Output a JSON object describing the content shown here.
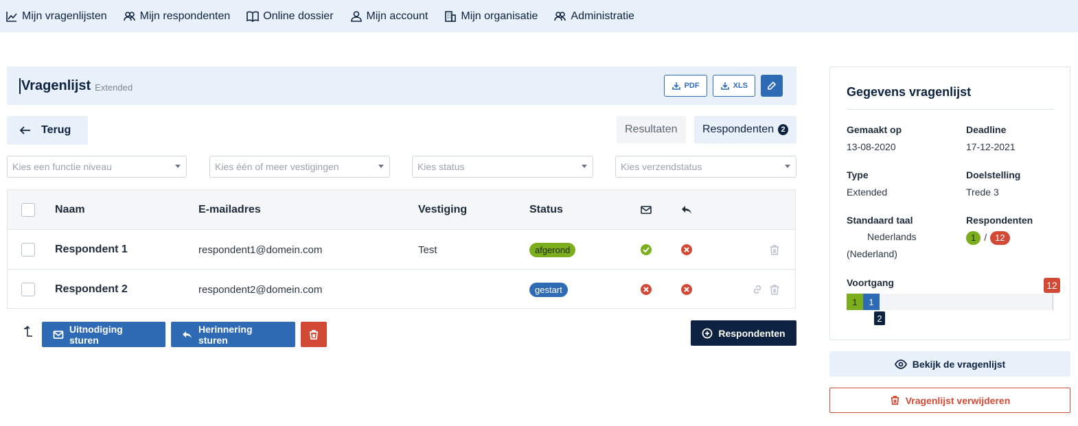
{
  "nav": [
    {
      "label": "Mijn vragenlijsten",
      "icon": "chart-icon"
    },
    {
      "label": "Mijn respondenten",
      "icon": "users-icon"
    },
    {
      "label": "Online dossier",
      "icon": "book-icon"
    },
    {
      "label": "Mijn account",
      "icon": "user-icon"
    },
    {
      "label": "Mijn organisatie",
      "icon": "building-icon"
    },
    {
      "label": "Administratie",
      "icon": "users-icon"
    }
  ],
  "header": {
    "title": "Vragenlijst",
    "subtitle": "Extended",
    "pdf_label": "PDF",
    "xls_label": "XLS"
  },
  "back_label": "Terug",
  "tabs": {
    "results_label": "Resultaten",
    "respondents_label": "Respondenten",
    "respondents_count": "2"
  },
  "filters": {
    "level": "Kies een functie niveau",
    "locations": "Kies één of meer vestigingen",
    "status": "Kies status",
    "send_status": "Kies verzendstatus"
  },
  "table": {
    "columns": {
      "name": "Naam",
      "email": "E-mailadres",
      "location": "Vestiging",
      "status": "Status"
    },
    "rows": [
      {
        "name": "Respondent 1",
        "email": "respondent1@domein.com",
        "location": "Test",
        "status": "afgerond",
        "invited": true,
        "reminded": false
      },
      {
        "name": "Respondent 2",
        "email": "respondent2@domein.com",
        "location": "",
        "status": "gestart",
        "invited": false,
        "reminded": false
      }
    ]
  },
  "actions": {
    "invite_label": "Uitnodiging sturen",
    "remind_label": "Herinnering sturen",
    "add_label": "Respondenten"
  },
  "panel": {
    "title": "Gegevens vragenlijst",
    "created_label": "Gemaakt op",
    "created_value": "13-08-2020",
    "deadline_label": "Deadline",
    "deadline_value": "17-12-2021",
    "type_label": "Type",
    "type_value": "Extended",
    "goal_label": "Doelstelling",
    "goal_value": "Trede 3",
    "language_label": "Standaard taal",
    "language_value": "Nederlands",
    "language_region": "(Nederland)",
    "respondents_label": "Respondenten",
    "respondents_done": "1",
    "respondents_sep": "/",
    "respondents_total": "12",
    "progress_label": "Voortgang",
    "progress": {
      "completed": 1,
      "started": 1,
      "total": 12,
      "started_sum": "2"
    }
  },
  "side_actions": {
    "view_label": "Bekijk de vragenlijst",
    "delete_label": "Vragenlijst verwijderen"
  },
  "colors": {
    "primary": "#2f6bb5",
    "navy": "#0d2240",
    "success": "#7cad1c",
    "danger": "#d24a36",
    "light_bg": "#e8f0fa"
  }
}
